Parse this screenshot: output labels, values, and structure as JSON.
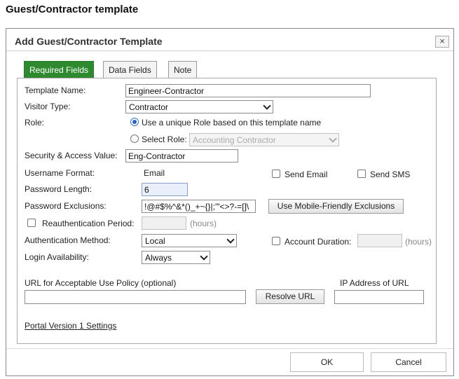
{
  "page": {
    "title": "Guest/Contractor template"
  },
  "dialog": {
    "title": "Add Guest/Contractor Template",
    "close_label": "×",
    "tabs": [
      "Required Fields",
      "Data Fields",
      "Note"
    ],
    "active_tab": "Required Fields",
    "form": {
      "template_name": {
        "label": "Template Name:",
        "value": "Engineer-Contractor"
      },
      "visitor_type": {
        "label": "Visitor Type:",
        "value": "Contractor"
      },
      "role": {
        "label": "Role:",
        "option_unique": "Use a unique Role based on this template name",
        "option_select": "Select Role:",
        "select_value": "Accounting Contractor",
        "selected": "unique"
      },
      "security_access": {
        "label": "Security & Access Value:",
        "value": "Eng-Contractor"
      },
      "username_format": {
        "label": "Username Format:",
        "value": "Email"
      },
      "send_email": {
        "label": "Send Email",
        "checked": false
      },
      "send_sms": {
        "label": "Send SMS",
        "checked": false
      },
      "password_length": {
        "label": "Password Length:",
        "value": "6"
      },
      "password_exclusions": {
        "label": "Password Exclusions:",
        "value": "!@#$%^&*()_+~{}|;'\"<>?-=[]\\",
        "button": "Use Mobile-Friendly Exclusions"
      },
      "reauth_period": {
        "label": "Reauthentication Period:",
        "units": "(hours)",
        "checked": false
      },
      "auth_method": {
        "label": "Authentication Method:",
        "value": "Local"
      },
      "account_duration": {
        "label": "Account Duration:",
        "units": "(hours)",
        "checked": false
      },
      "login_availability": {
        "label": "Login Availability:",
        "value": "Always"
      },
      "aup_url": {
        "label": "URL for Acceptable Use Policy (optional)",
        "value": "",
        "resolve_button": "Resolve URL"
      },
      "ip_address": {
        "label": "IP Address of URL",
        "value": ""
      },
      "portal_link": "Portal Version 1 Settings"
    },
    "footer": {
      "ok": "OK",
      "cancel": "Cancel"
    }
  },
  "colors": {
    "active_tab": "#2f8a2f",
    "radio_selected": "#2a63b8",
    "highlight_field": "#e9f0fb"
  },
  "icons": [
    "close-icon",
    "chevron-down-icon",
    "radio-icon",
    "checkbox-icon"
  ]
}
